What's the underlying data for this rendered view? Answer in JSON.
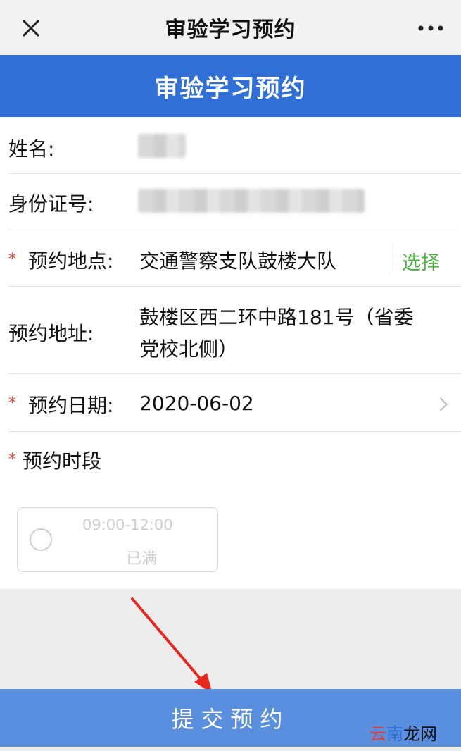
{
  "topbar": {
    "title": "审验学习预约"
  },
  "banner": {
    "title": "审验学习预约"
  },
  "form": {
    "name_label": "姓名:",
    "id_label": "身份证号:",
    "location_label": "预约地点:",
    "location_value": "交通警察支队鼓楼大队",
    "select_label": "选择",
    "address_label": "预约地址:",
    "address_line1": "鼓楼区西二环中路181号（省委",
    "address_line2": "党校北侧）",
    "date_label": "预约日期:",
    "date_value": "2020-06-02",
    "period_label": "预约时段",
    "required_mark": "*"
  },
  "slot": {
    "time": "09:00-12:00",
    "status": "已满"
  },
  "submit": {
    "label": "提交预约"
  },
  "watermark": {
    "part1": "云",
    "part2": "南",
    "part3": "龙网"
  },
  "colors": {
    "banner": "#2f6fd6",
    "submit": "#5a8fe0",
    "required": "#e0413a",
    "select": "#4caf3f"
  },
  "icons": {
    "close": "close-icon",
    "more": "more-icon",
    "chevron": "chevron-right-icon",
    "arrow": "red-arrow"
  }
}
